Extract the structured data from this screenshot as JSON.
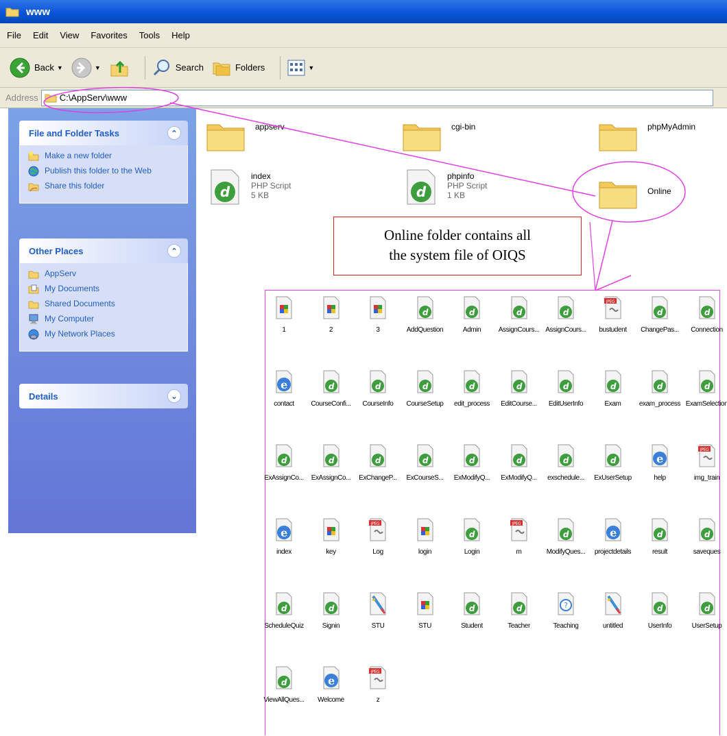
{
  "window": {
    "title": "www"
  },
  "menu": [
    "File",
    "Edit",
    "View",
    "Favorites",
    "Tools",
    "Help"
  ],
  "toolbar": {
    "back": "Back",
    "search": "Search",
    "folders": "Folders"
  },
  "address": {
    "label": "Address",
    "value": "C:\\AppServ\\www"
  },
  "tasks_panel": {
    "title": "File and Folder Tasks",
    "items": [
      "Make a new folder",
      "Publish this folder to the Web",
      "Share this folder"
    ]
  },
  "places_panel": {
    "title": "Other Places",
    "items": [
      "AppServ",
      "My Documents",
      "Shared Documents",
      "My Computer",
      "My Network Places"
    ]
  },
  "details_panel": {
    "title": "Details"
  },
  "main_items": [
    {
      "name": "appserv",
      "type": "",
      "size": ""
    },
    {
      "name": "cgi-bin",
      "type": "",
      "size": ""
    },
    {
      "name": "phpMyAdmin",
      "type": "",
      "size": ""
    },
    {
      "name": "index",
      "type": "PHP Script",
      "size": "5 KB"
    },
    {
      "name": "phpinfo",
      "type": "PHP Script",
      "size": "1 KB"
    },
    {
      "name": "Online",
      "type": "",
      "size": ""
    }
  ],
  "callout": {
    "line1": "Online folder contains all",
    "line2": "the system file of OIQS"
  },
  "online_files": [
    {
      "label": "1",
      "icon": "doc"
    },
    {
      "label": "2",
      "icon": "doc"
    },
    {
      "label": "3",
      "icon": "doc"
    },
    {
      "label": "AddQuestion",
      "icon": "php"
    },
    {
      "label": "Admin",
      "icon": "php"
    },
    {
      "label": "AssignCours...",
      "icon": "php"
    },
    {
      "label": "AssignCours...",
      "icon": "php"
    },
    {
      "label": "bustudent",
      "icon": "jpeg"
    },
    {
      "label": "ChangePas...",
      "icon": "php"
    },
    {
      "label": "Connection",
      "icon": "php"
    },
    {
      "label": "contact",
      "icon": "ie"
    },
    {
      "label": "CourseConfi...",
      "icon": "php"
    },
    {
      "label": "CourseInfo",
      "icon": "php"
    },
    {
      "label": "CourseSetup",
      "icon": "php"
    },
    {
      "label": "edit_process",
      "icon": "php"
    },
    {
      "label": "EditCourse...",
      "icon": "php"
    },
    {
      "label": "EditUserInfo",
      "icon": "php"
    },
    {
      "label": "Exam",
      "icon": "php"
    },
    {
      "label": "exam_process",
      "icon": "php"
    },
    {
      "label": "ExamSelection",
      "icon": "php"
    },
    {
      "label": "ExAssignCo...",
      "icon": "php"
    },
    {
      "label": "ExAssignCo...",
      "icon": "php"
    },
    {
      "label": "ExChangeP...",
      "icon": "php"
    },
    {
      "label": "ExCourseS...",
      "icon": "php"
    },
    {
      "label": "ExModifyQ...",
      "icon": "php"
    },
    {
      "label": "ExModifyQ...",
      "icon": "php"
    },
    {
      "label": "exschedule...",
      "icon": "php"
    },
    {
      "label": "ExUserSetup",
      "icon": "php"
    },
    {
      "label": "help",
      "icon": "ie"
    },
    {
      "label": "img_train",
      "icon": "jpeg"
    },
    {
      "label": "index",
      "icon": "ie"
    },
    {
      "label": "key",
      "icon": "doc"
    },
    {
      "label": "Log",
      "icon": "jpeg"
    },
    {
      "label": "login",
      "icon": "doc"
    },
    {
      "label": "Login",
      "icon": "php"
    },
    {
      "label": "m",
      "icon": "jpeg"
    },
    {
      "label": "ModifyQues...",
      "icon": "php"
    },
    {
      "label": "projectdetails",
      "icon": "ie"
    },
    {
      "label": "result",
      "icon": "php"
    },
    {
      "label": "saveques",
      "icon": "php"
    },
    {
      "label": "ScheduleQuiz",
      "icon": "php"
    },
    {
      "label": "Signin",
      "icon": "php"
    },
    {
      "label": "STU",
      "icon": "paint"
    },
    {
      "label": "STU",
      "icon": "doc"
    },
    {
      "label": "Student",
      "icon": "php"
    },
    {
      "label": "Teacher",
      "icon": "php"
    },
    {
      "label": "Teaching",
      "icon": "help"
    },
    {
      "label": "untitled",
      "icon": "paint"
    },
    {
      "label": "UserInfo",
      "icon": "php"
    },
    {
      "label": "UserSetup",
      "icon": "php"
    },
    {
      "label": "ViewAllQues...",
      "icon": "php"
    },
    {
      "label": "Welcome",
      "icon": "ie"
    },
    {
      "label": "z",
      "icon": "jpeg"
    }
  ],
  "colors": {
    "xp_blue": "#0a55d8",
    "task_pane": "#6e8fe0",
    "annotation": "#e040e0",
    "callout_border": "#e02020"
  }
}
